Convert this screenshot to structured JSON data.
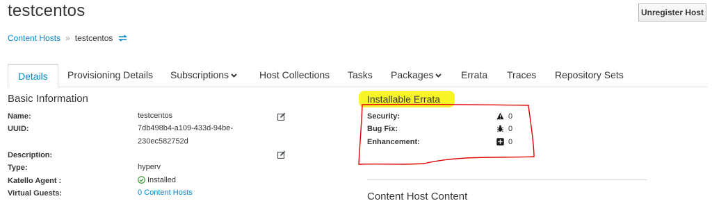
{
  "header": {
    "title": "testcentos",
    "unregister_label": "Unregister Host"
  },
  "breadcrumb": {
    "parent": "Content Hosts",
    "separator": "»",
    "current": "testcentos"
  },
  "tabs": [
    {
      "label": "Details",
      "active": true
    },
    {
      "label": "Provisioning Details"
    },
    {
      "label": "Subscriptions",
      "dropdown": true
    },
    {
      "label": "Host Collections"
    },
    {
      "label": "Tasks"
    },
    {
      "label": "Packages",
      "dropdown": true
    },
    {
      "label": "Errata"
    },
    {
      "label": "Traces"
    },
    {
      "label": "Repository Sets"
    }
  ],
  "basic_info": {
    "title": "Basic Information",
    "name_label": "Name:",
    "name_value": "testcentos",
    "uuid_label": "UUID:",
    "uuid_line1": "7db498b4-a109-433d-94be-",
    "uuid_line2": "230ec582752d",
    "description_label": "Description:",
    "type_label": "Type:",
    "type_value": "hyperv",
    "agent_label": "Katello Agent :",
    "agent_value": "Installed",
    "guests_label": "Virtual Guests:",
    "guests_value": "0 Content Hosts"
  },
  "errata": {
    "title": "Installable Errata",
    "security_label": "Security:",
    "security_count": "0",
    "bugfix_label": "Bug Fix:",
    "bugfix_count": "0",
    "enhancement_label": "Enhancement:",
    "enhancement_count": "0"
  },
  "content_host_content": {
    "title": "Content Host Content"
  },
  "colors": {
    "link": "#0088ce",
    "highlight": "#f7f41c",
    "annotation": "#e00000",
    "success": "#3f9c35"
  }
}
